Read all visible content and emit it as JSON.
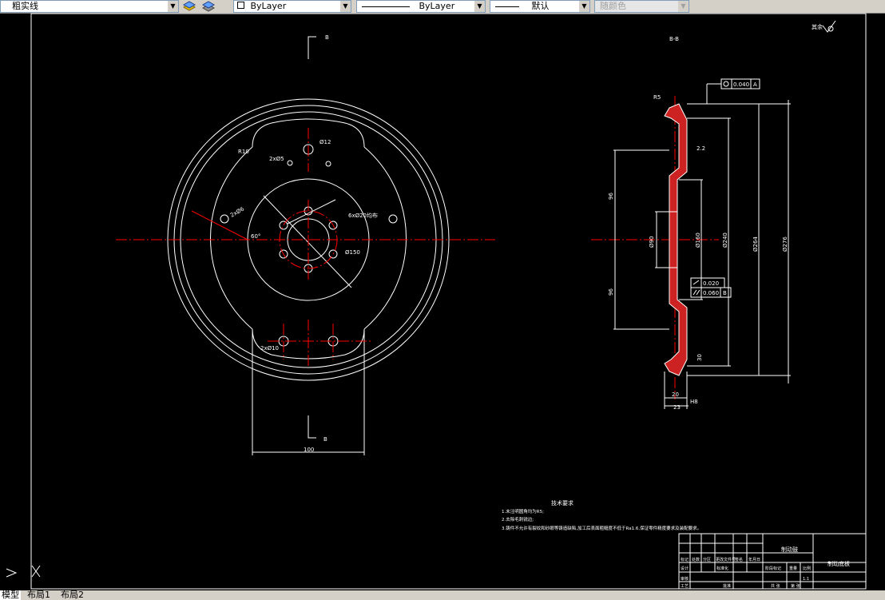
{
  "toolbar": {
    "linetype_combo": "粗实线",
    "color_combo": "ByLayer",
    "linetype2_combo": "ByLayer",
    "lineweight_combo": "默认",
    "plotstyle_combo": "随颜色"
  },
  "colors": {
    "toolbar_bg": "#d4d0c8",
    "canvas_bg": "#000000",
    "geometry": "#ffffff",
    "centerline": "#ff0000",
    "section_hatch": "#cc2222"
  },
  "drawing": {
    "section_mark_top": "B",
    "section_mark_bottom": "B",
    "section_title": "B-B",
    "roughness_note": "其余",
    "dim_hole_12": "Ø12",
    "dim_r_small": "R10",
    "dim_2x5": "2xØ5",
    "dim_2x6": "2xØ6",
    "dim_bolt_holes": "6xØ20均布",
    "dim_circle_150": "Ø150",
    "dim_angle": "60°",
    "dim_2x10": "2xØ10",
    "dim_width_100": "100",
    "dim_r_corner": "R5",
    "gdt_top": "0.040",
    "gdt_top_datum": "A",
    "gdt_flat": "0.020",
    "gdt_parallel": "0.060",
    "gdt_datum_b": "B",
    "dim_d90": "Ø90",
    "dim_d160": "Ø160",
    "dim_d240": "Ø240",
    "dim_d264": "Ø264",
    "dim_d276": "Ø276",
    "dim_v96_top": "96",
    "dim_v96_bot": "96",
    "dim_small_2_2": "2.2",
    "dim_20": "20",
    "dim_23": "23",
    "dim_30": "30",
    "datum_marker": "H8"
  },
  "notes": {
    "title": "技术要求",
    "line1": "1.未注明圆角均为R5;",
    "line2": "2.去除毛刺锐边;",
    "line3": "3.铸件不允许有裂纹和砂眼等铸造缺陷,加工后表面粗糙度不低于Ra1.6,保证零件精度要求及装配要求。"
  },
  "title_block": {
    "part_name": "制动鼓",
    "drawing_name": "制动底板",
    "labels": [
      "标记",
      "处数",
      "分区",
      "更改文件号",
      "签名",
      "年月日",
      "设计",
      "标准化",
      "阶段标记",
      "重量",
      "比例",
      "审核",
      "工艺",
      "批准",
      "共 张",
      "第 张"
    ],
    "scale": "1:1"
  },
  "layout_tabs": [
    "模型",
    "布局1",
    "布局2"
  ],
  "active_tab": "模型"
}
